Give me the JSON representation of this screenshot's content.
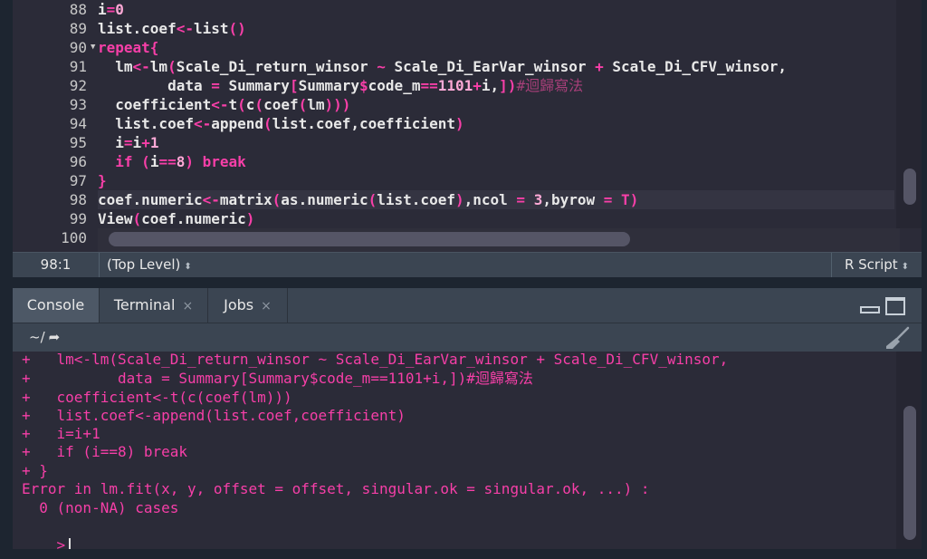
{
  "editor": {
    "line_numbers": [
      "88",
      "89",
      "90",
      "91",
      "92",
      "93",
      "94",
      "95",
      "96",
      "97",
      "98",
      "99",
      "100"
    ],
    "lines": [
      "i=0",
      "list.coef<-list()",
      "repeat{",
      "  lm<-lm(Scale_Di_return_winsor ~ Scale_Di_EarVar_winsor + Scale_Di_CFV_winsor,",
      "        data = Summary[Summary$code_m==1101+i,])#迴歸寫法",
      "  coefficient<-t(c(coef(lm)))",
      "  list.coef<-append(list.coef,coefficient)",
      "  i=i+1",
      "  if (i==8) break",
      "}",
      "coef.numeric<-matrix(as.numeric(list.coef),ncol = 3,byrow = T)",
      "View(coef.numeric)",
      ""
    ]
  },
  "status": {
    "position": "98:1",
    "scope": "(Top Level)",
    "file_type": "R Script"
  },
  "tabs": [
    {
      "label": "Console"
    },
    {
      "label": "Terminal",
      "close": "×"
    },
    {
      "label": "Jobs",
      "close": "×"
    }
  ],
  "console": {
    "working_dir": "~/",
    "lines": [
      "+   lm<-lm(Scale_Di_return_winsor ~ Scale_Di_EarVar_winsor + Scale_Di_CFV_winsor,",
      "+          data = Summary[Summary$code_m==1101+i,])#迴歸寫法",
      "+   coefficient<-t(c(coef(lm)))",
      "+   list.coef<-append(list.coef,coefficient)",
      "+   i=i+1",
      "+   if (i==8) break",
      "+ }",
      "Error in lm.fit(x, y, offset = offset, singular.ok = singular.ok, ...) :",
      "  0 (non-NA) cases"
    ],
    "prompt": ">"
  },
  "colors": {
    "editor_bg": "#2b2b38",
    "keyword": "#f73fa8",
    "number": "#ffa9d6",
    "comment": "#a73f79",
    "text": "#e8e8e8",
    "chrome": "#3b4552"
  }
}
